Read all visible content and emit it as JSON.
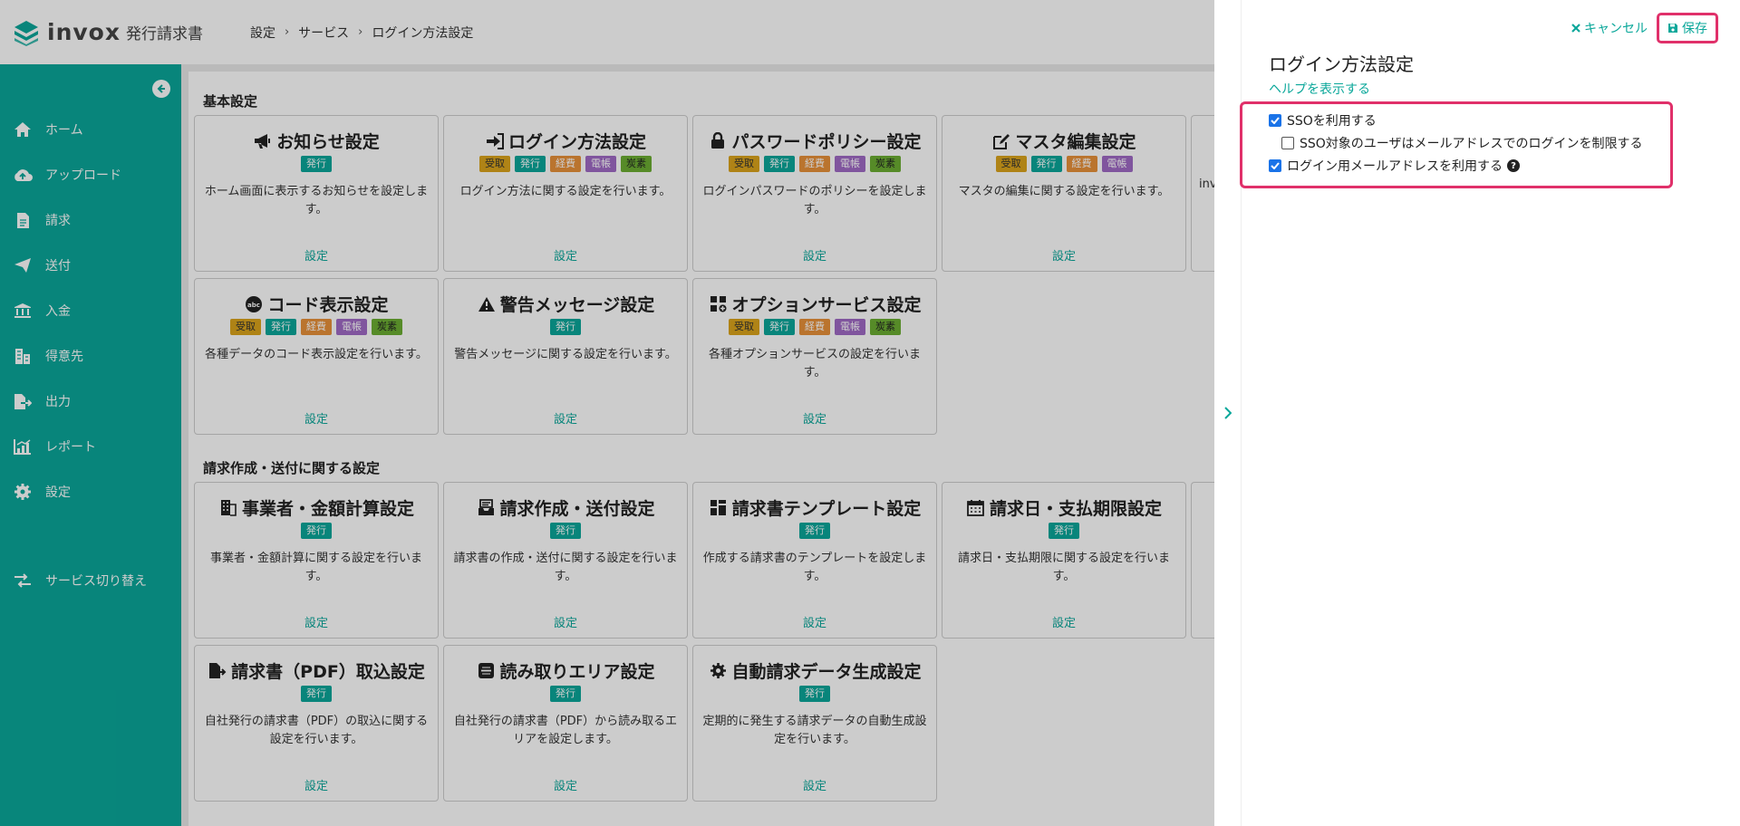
{
  "header": {
    "logo_text": "invox",
    "logo_sub": "発行請求書",
    "breadcrumb": [
      "設定",
      "サービス",
      "ログイン方法設定"
    ]
  },
  "sidebar": {
    "items": [
      {
        "label": "ホーム",
        "icon": "home-icon"
      },
      {
        "label": "アップロード",
        "icon": "cloud-upload-icon"
      },
      {
        "label": "請求",
        "icon": "document-icon"
      },
      {
        "label": "送付",
        "icon": "paper-plane-icon"
      },
      {
        "label": "入金",
        "icon": "bank-icon"
      },
      {
        "label": "得意先",
        "icon": "building-icon"
      },
      {
        "label": "出力",
        "icon": "file-export-icon"
      },
      {
        "label": "レポート",
        "icon": "chart-icon"
      },
      {
        "label": "設定",
        "icon": "gear-icon"
      }
    ],
    "switch_label": "サービス切り替え"
  },
  "main": {
    "section1_title": "基本設定",
    "section2_title": "請求作成・送付に関する設定",
    "badge_labels": {
      "recv": "受取",
      "issue": "発行",
      "exp": "経費",
      "ebook": "電帳",
      "carbon": "炭素"
    },
    "cards": [
      {
        "title": "お知らせ設定",
        "icon": "megaphone-icon",
        "badges": [
          "issue"
        ],
        "desc": "ホーム画面に表示するお知らせを設定します。",
        "link": "設定"
      },
      {
        "title": "ログイン方法設定",
        "icon": "sign-in-icon",
        "badges": [
          "recv",
          "issue",
          "exp",
          "ebook",
          "carbon"
        ],
        "desc": "ログイン方法に関する設定を行います。",
        "link": "設定"
      },
      {
        "title": "パスワードポリシー設定",
        "icon": "lock-icon",
        "badges": [
          "recv",
          "issue",
          "exp",
          "ebook",
          "carbon"
        ],
        "desc": "ログインパスワードのポリシーを設定します。",
        "link": "設定"
      },
      {
        "title": "マスタ編集設定",
        "icon": "edit-icon",
        "badges": [
          "recv",
          "issue",
          "exp",
          "ebook"
        ],
        "desc": "マスタの編集に関する設定を行います。",
        "link": "設定"
      },
      {
        "title": "コード表示設定",
        "icon": "abc-icon",
        "badges": [
          "recv",
          "issue",
          "exp",
          "ebook",
          "carbon"
        ],
        "desc": "各種データのコード表示設定を行います。",
        "link": "設定"
      },
      {
        "title": "警告メッセージ設定",
        "icon": "warning-icon",
        "badges": [
          "issue"
        ],
        "desc": "警告メッセージに関する設定を行います。",
        "link": "設定"
      },
      {
        "title": "オプションサービス設定",
        "icon": "grid-plus-icon",
        "badges": [
          "recv",
          "issue",
          "exp",
          "ebook",
          "carbon"
        ],
        "desc": "各種オプションサービスの設定を行います。",
        "link": "設定"
      },
      {
        "title": "事業者・金額計算設定",
        "icon": "building-icon",
        "badges": [
          "issue"
        ],
        "desc": "事業者・金額計算に関する設定を行います。",
        "link": "設定"
      },
      {
        "title": "請求作成・送付設定",
        "icon": "inbox-icon",
        "badges": [
          "issue"
        ],
        "desc": "請求書の作成・送付に関する設定を行います。",
        "link": "設定"
      },
      {
        "title": "請求書テンプレート設定",
        "icon": "template-icon",
        "badges": [
          "issue"
        ],
        "desc": "作成する請求書のテンプレートを設定します。",
        "link": "設定"
      },
      {
        "title": "請求日・支払期限設定",
        "icon": "calendar-icon",
        "badges": [
          "issue"
        ],
        "desc": "請求日・支払期限に関する設定を行います。",
        "link": "設定"
      },
      {
        "title": "請求書（PDF）取込設定",
        "icon": "file-import-icon",
        "badges": [
          "issue"
        ],
        "desc": "自社発行の請求書（PDF）の取込に関する設定を行います。",
        "link": "設定"
      },
      {
        "title": "読み取りエリア設定",
        "icon": "scan-icon",
        "badges": [
          "issue"
        ],
        "desc": "自社発行の請求書（PDF）から読み取るエリアを設定します。",
        "link": "設定"
      },
      {
        "title": "自動請求データ生成設定",
        "icon": "cog-icon",
        "badges": [
          "issue"
        ],
        "desc": "定期的に発生する請求データの自動生成設定を行います。",
        "link": "設定"
      }
    ],
    "partial_card_desc": "inv"
  },
  "panel": {
    "cancel_label": "キャンセル",
    "save_label": "保存",
    "title": "ログイン方法設定",
    "help_link": "ヘルプを表示する",
    "options": [
      {
        "label": "SSOを利用する",
        "checked": true
      },
      {
        "label": "SSO対象のユーザはメールアドレスでのログインを制限する",
        "checked": false
      },
      {
        "label": "ログイン用メールアドレスを利用する",
        "checked": true
      }
    ]
  },
  "colors": {
    "accent": "#0aa79a",
    "highlight": "#e0306a",
    "checkbox": "#1a73e8"
  }
}
